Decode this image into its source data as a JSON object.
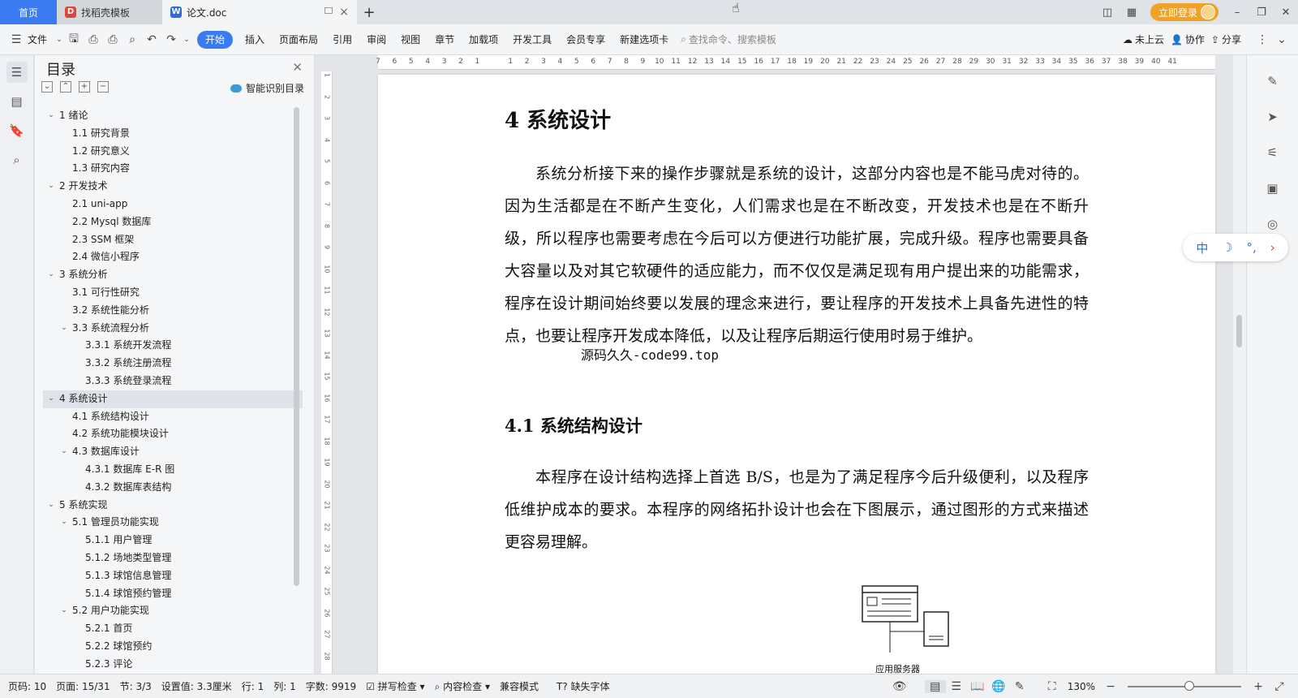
{
  "tabs": {
    "home": "首页",
    "template": "找稻壳模板",
    "doc": "论文.doc",
    "new_tab": "+"
  },
  "header_right": {
    "login": "立即登录"
  },
  "toolbar": {
    "file": "文件",
    "start": "开始",
    "insert": "插入",
    "layout": "页面布局",
    "reference": "引用",
    "review": "审阅",
    "view": "视图",
    "chapter": "章节",
    "addons": "加载项",
    "devtools": "开发工具",
    "member": "会员专享",
    "new_tab": "新建选项卡",
    "search_placeholder": "查找命令、搜索模板",
    "cloud": "未上云",
    "collab": "协作",
    "share": "分享"
  },
  "toc": {
    "title": "目录",
    "smart": "智能识别目录",
    "items": [
      {
        "label": "1  绪论",
        "level": 1,
        "arrow": true
      },
      {
        "label": "1.1  研究背景",
        "level": 2
      },
      {
        "label": "1.2  研究意义",
        "level": 2
      },
      {
        "label": "1.3  研究内容",
        "level": 2
      },
      {
        "label": "2  开发技术",
        "level": 1,
        "arrow": true
      },
      {
        "label": "2.1 uni-app",
        "level": 2
      },
      {
        "label": "2.2 Mysql 数据库",
        "level": 2
      },
      {
        "label": "2.3 SSM 框架",
        "level": 2
      },
      {
        "label": "2.4  微信小程序",
        "level": 2
      },
      {
        "label": "3  系统分析",
        "level": 1,
        "arrow": true
      },
      {
        "label": "3.1 可行性研究",
        "level": 2
      },
      {
        "label": "3.2 系统性能分析",
        "level": 2
      },
      {
        "label": "3.3  系统流程分析",
        "level": 2,
        "arrow": true
      },
      {
        "label": "3.3.1  系统开发流程",
        "level": 3
      },
      {
        "label": "3.3.2  系统注册流程",
        "level": 3
      },
      {
        "label": "3.3.3  系统登录流程",
        "level": 3
      },
      {
        "label": "4  系统设计",
        "level": 1,
        "arrow": true,
        "selected": true
      },
      {
        "label": "4.1  系统结构设计",
        "level": 2
      },
      {
        "label": "4.2 系统功能模块设计",
        "level": 2
      },
      {
        "label": "4.3 数据库设计",
        "level": 2,
        "arrow": true
      },
      {
        "label": "4.3.1 数据库 E-R 图",
        "level": 3
      },
      {
        "label": "4.3.2  数据库表结构",
        "level": 3
      },
      {
        "label": "5  系统实现",
        "level": 1,
        "arrow": true
      },
      {
        "label": "5.1  管理员功能实现",
        "level": 2,
        "arrow": true
      },
      {
        "label": "5.1.1  用户管理",
        "level": 3
      },
      {
        "label": "5.1.2  场地类型管理",
        "level": 3
      },
      {
        "label": "5.1.3  球馆信息管理",
        "level": 3
      },
      {
        "label": "5.1.4  球馆预约管理",
        "level": 3
      },
      {
        "label": "5.2  用户功能实现",
        "level": 2,
        "arrow": true
      },
      {
        "label": "5.2.1  首页",
        "level": 3
      },
      {
        "label": "5.2.2  球馆预约",
        "level": 3
      },
      {
        "label": "5.2.3  评论",
        "level": 3
      }
    ]
  },
  "ruler": {
    "h_ticks": [
      "7",
      "6",
      "5",
      "4",
      "3",
      "2",
      "1",
      "",
      "1",
      "2",
      "3",
      "4",
      "5",
      "6",
      "7",
      "8",
      "9",
      "10",
      "11",
      "12",
      "13",
      "14",
      "15",
      "16",
      "17",
      "18",
      "19",
      "20",
      "21",
      "22",
      "23",
      "24",
      "25",
      "26",
      "27",
      "28",
      "29",
      "30",
      "31",
      "32",
      "33",
      "34",
      "35",
      "36",
      "37",
      "38",
      "39",
      "40",
      "41"
    ],
    "v_ticks": [
      "1",
      "2",
      "3",
      "4",
      "5",
      "6",
      "7",
      "8",
      "9",
      "10",
      "11",
      "12",
      "13",
      "14",
      "15",
      "16",
      "17",
      "18",
      "19",
      "20",
      "21",
      "22",
      "23",
      "24",
      "25",
      "26",
      "27",
      "28"
    ]
  },
  "document": {
    "heading": "4  系统设计",
    "para1": "系统分析接下来的操作步骤就是系统的设计，这部分内容也是不能马虎对待的。因为生活都是在不断产生变化，人们需求也是在不断改变，开发技术也是在不断升级，所以程序也需要考虑在今后可以方便进行功能扩展，完成升级。程序也需要具备大容量以及对其它软硬件的适应能力，而不仅仅是满足现有用户提出来的功能需求，程序在设计期间始终要以发展的理念来进行，要让程序的开发技术上具备先进性的特点，也要让程序开发成本降低，以及让程序后期运行使用时易于维护。",
    "watermark": "源码久久-code99.top",
    "subheading": "4.1  系统结构设计",
    "para2": "本程序在设计结构选择上首选 B/S，也是为了满足程序今后升级便利，以及程序低维护成本的要求。本程序的网络拓扑设计也会在下图展示，通过图形的方式来描述更容易理解。",
    "diagram_label": "应用服务器"
  },
  "ime": {
    "lang": "中"
  },
  "status": {
    "page_code": "页码: 10",
    "page": "页面: 15/31",
    "section": "节: 3/3",
    "setting": "设置值: 3.3厘米",
    "row": "行: 1",
    "col": "列: 1",
    "words": "字数: 9919",
    "spell": "拼写检查",
    "content_check": "内容检查",
    "compat": "兼容模式",
    "missing_font": "缺失字体",
    "zoom": "130%"
  }
}
